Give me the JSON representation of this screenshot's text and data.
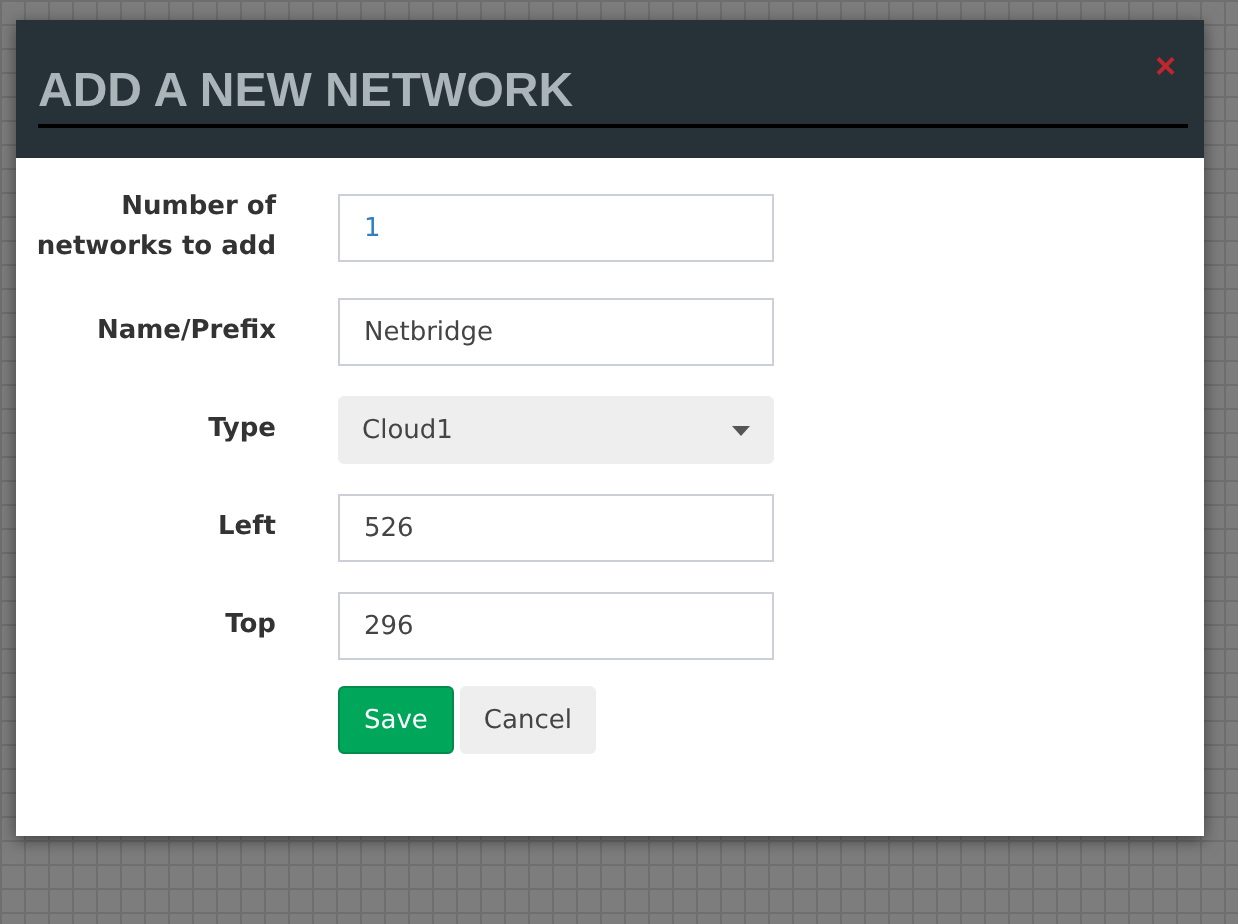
{
  "dialog": {
    "title": "ADD A NEW NETWORK",
    "close": "×"
  },
  "fields": [
    {
      "kind": "input",
      "label": "Number of networks to add",
      "value": "1"
    },
    {
      "kind": "input",
      "label": "Name/Prefix",
      "value": "Netbridge"
    },
    {
      "kind": "select",
      "label": "Type",
      "value": "Cloud1"
    },
    {
      "kind": "input",
      "label": "Left",
      "value": "526"
    },
    {
      "kind": "input",
      "label": "Top",
      "value": "296"
    }
  ],
  "buttons": [
    {
      "kind": "primary",
      "label": "Save"
    },
    {
      "kind": "default",
      "label": "Cancel"
    }
  ]
}
